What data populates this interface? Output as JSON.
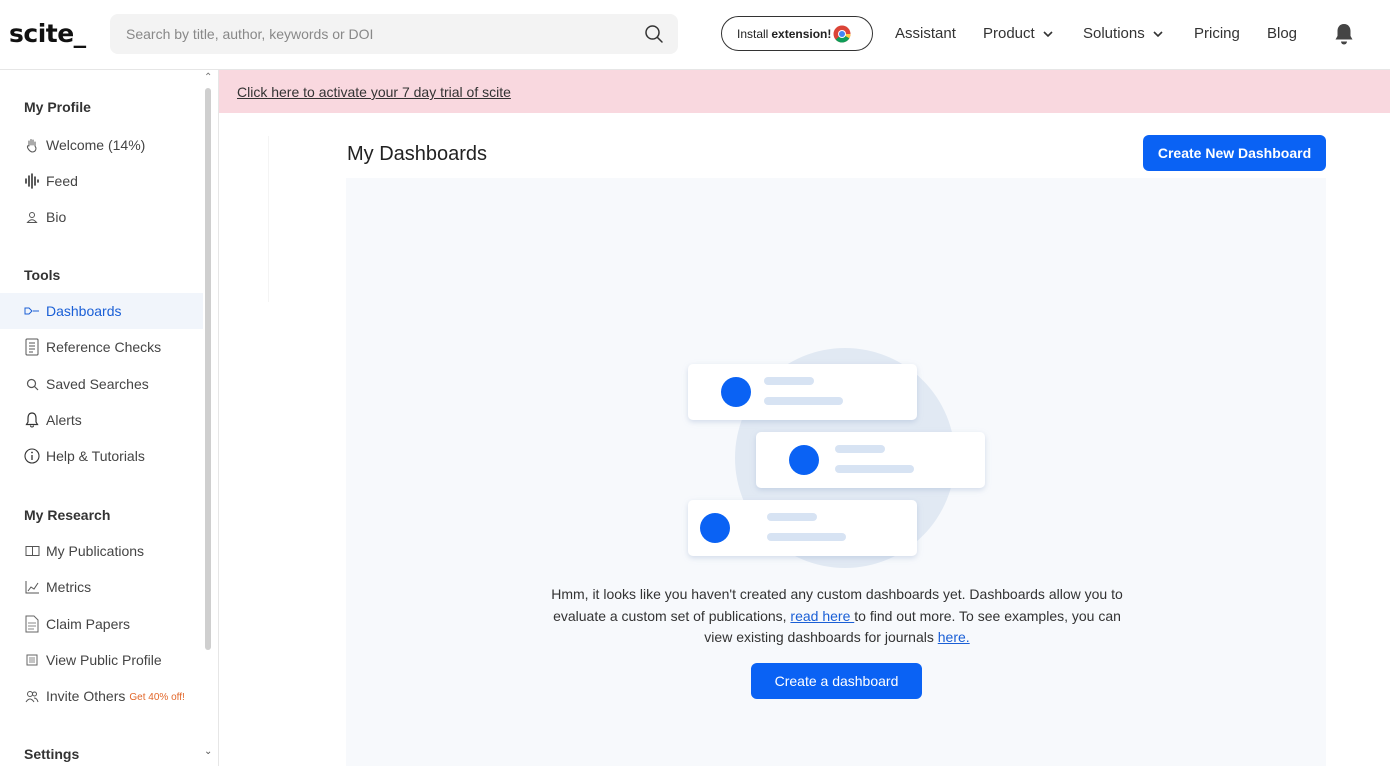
{
  "header": {
    "logo": "scite_",
    "search_placeholder": "Search by title, author, keywords or DOI",
    "install_prefix": "Install",
    "install_bold": "extension!",
    "nav": {
      "assistant": "Assistant",
      "product": "Product",
      "solutions": "Solutions",
      "pricing": "Pricing",
      "blog": "Blog"
    }
  },
  "sidebar": {
    "sections": {
      "profile": "My Profile",
      "tools": "Tools",
      "research": "My Research",
      "settings": "Settings"
    },
    "profile_items": [
      {
        "label": "Welcome (14%)",
        "icon": "hand-wave-icon"
      },
      {
        "label": "Feed",
        "icon": "soundwave-icon"
      },
      {
        "label": "Bio",
        "icon": "user-icon"
      }
    ],
    "tool_items": [
      {
        "label": "Dashboards",
        "icon": "dashboard-icon",
        "active": true
      },
      {
        "label": "Reference Checks",
        "icon": "document-icon"
      },
      {
        "label": "Saved Searches",
        "icon": "search-icon"
      },
      {
        "label": "Alerts",
        "icon": "bell-icon"
      },
      {
        "label": "Help & Tutorials",
        "icon": "info-icon"
      }
    ],
    "research_items": [
      {
        "label": "My Publications",
        "icon": "book-icon"
      },
      {
        "label": "Metrics",
        "icon": "chart-icon"
      },
      {
        "label": "Claim Papers",
        "icon": "paper-icon"
      },
      {
        "label": "View Public Profile",
        "icon": "profile-card-icon"
      },
      {
        "label": "Invite Others",
        "icon": "users-icon",
        "promo": "Get 40% off!"
      }
    ]
  },
  "banner": {
    "text": "Click here to activate your 7 day trial of scite"
  },
  "main": {
    "title": "My Dashboards",
    "create_new_label": "Create New Dashboard",
    "empty": {
      "text1": "Hmm, it looks like you haven't created any custom dashboards yet. Dashboards allow you to evaluate a custom set of publications, ",
      "link1": "read here ",
      "text2": "to find out more. To see examples, you can view existing dashboards for journals ",
      "link2": "here.",
      "button": "Create a dashboard"
    }
  },
  "colors": {
    "accent": "#0a62f4",
    "banner": "#f9d8df",
    "active_bg": "#f1f5fb",
    "promo": "#e2672a"
  }
}
